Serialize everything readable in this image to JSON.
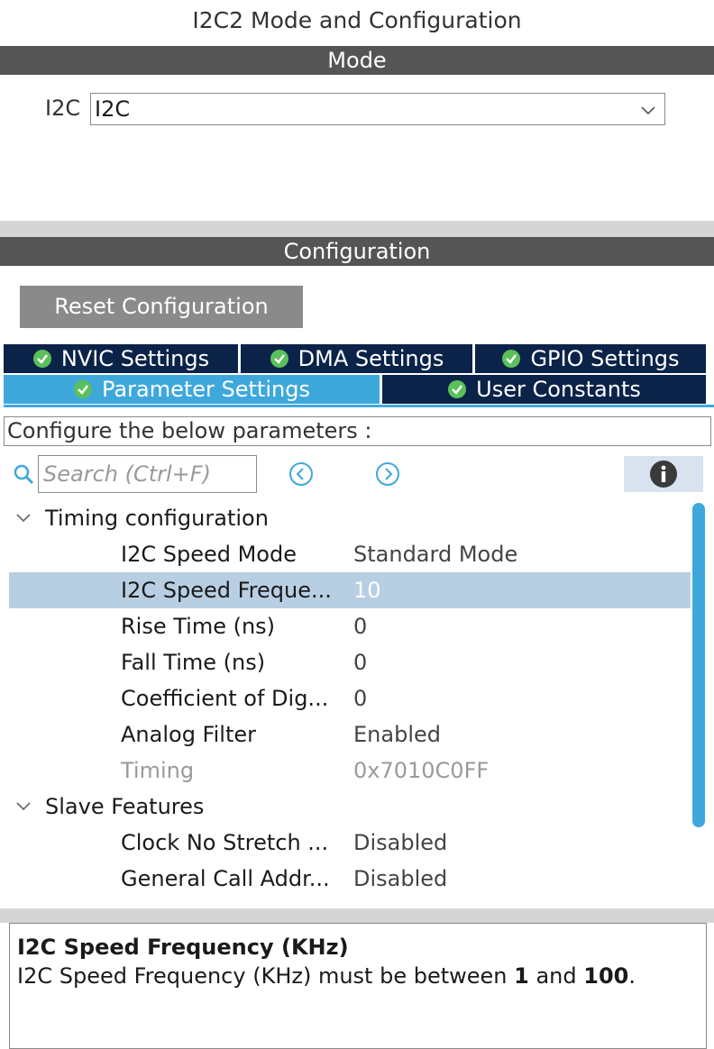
{
  "window": {
    "title": "I2C2 Mode and Configuration"
  },
  "mode": {
    "header": "Mode",
    "label": "I2C",
    "select_value": "I2C"
  },
  "configuration": {
    "header": "Configuration",
    "reset_label": "Reset Configuration",
    "tabs_row1": [
      {
        "label": "NVIC Settings",
        "icon": "check-circle-icon"
      },
      {
        "label": "DMA Settings",
        "icon": "check-circle-icon"
      },
      {
        "label": "GPIO Settings",
        "icon": "check-circle-icon"
      }
    ],
    "tabs_row2": [
      {
        "label": "Parameter Settings",
        "icon": "check-circle-icon",
        "active": true
      },
      {
        "label": "User Constants",
        "icon": "check-circle-icon"
      }
    ],
    "hint": "Configure the below parameters :",
    "search_placeholder": "Search (Ctrl+F)",
    "groups": [
      {
        "name": "Timing configuration",
        "params": [
          {
            "name": "I2C Speed Mode",
            "value": "Standard Mode"
          },
          {
            "name": "I2C Speed Freque...",
            "value": "10",
            "selected": true
          },
          {
            "name": "Rise Time (ns)",
            "value": "0"
          },
          {
            "name": "Fall Time (ns)",
            "value": "0"
          },
          {
            "name": "Coefficient of Dig...",
            "value": "0"
          },
          {
            "name": "Analog Filter",
            "value": "Enabled"
          },
          {
            "name": "Timing",
            "value": "0x7010C0FF",
            "disabled": true
          }
        ]
      },
      {
        "name": "Slave Features",
        "params": [
          {
            "name": "Clock No Stretch ...",
            "value": "Disabled"
          },
          {
            "name": "General Call Addr...",
            "value": "Disabled"
          }
        ]
      }
    ],
    "description": {
      "title": "I2C Speed Frequency (KHz)",
      "text_before": "I2C Speed Frequency (KHz) must be between ",
      "min": "1",
      "text_mid": " and ",
      "max": "100",
      "text_after": "."
    }
  },
  "colors": {
    "accent": "#3ea8dc",
    "tab_dark": "#0b2348",
    "header_bar": "#555555",
    "selection": "#b8cfe3"
  }
}
